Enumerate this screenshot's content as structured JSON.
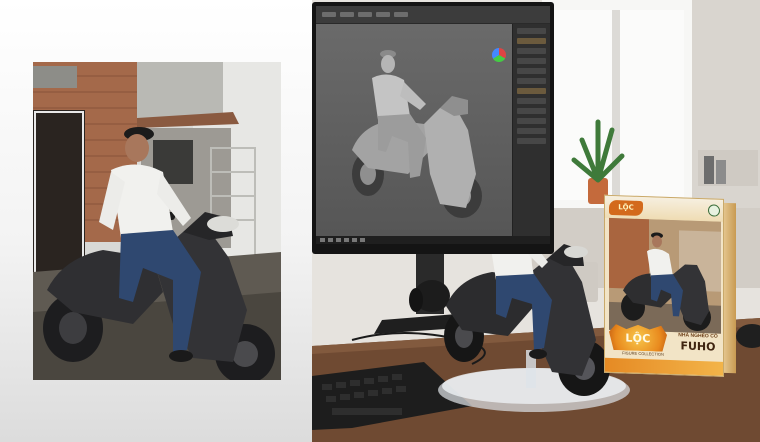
{
  "left_photo": {
    "subject": "man in white shirt and cap sitting on a dark grey scooter in front of a brick wall"
  },
  "monitor": {
    "content": "3D modeling software showing a grey sculpt of a man on a scooter"
  },
  "figurine": {
    "base": "clear acrylic round stand"
  },
  "product_box": {
    "logo_top": "LỘC FUHO",
    "brand": "LỘC FUHO",
    "subtitle": "FIGURE COLLECTION",
    "tagline": "NHÀ NGHÈO CÓ",
    "name": "FUHO"
  },
  "colors": {
    "box_orange": "#e98a1e",
    "desk_wood": "#6f4a32",
    "scooter": "#2c2c2e",
    "shirt": "#f1f1ee",
    "jeans": "#2f4870"
  }
}
